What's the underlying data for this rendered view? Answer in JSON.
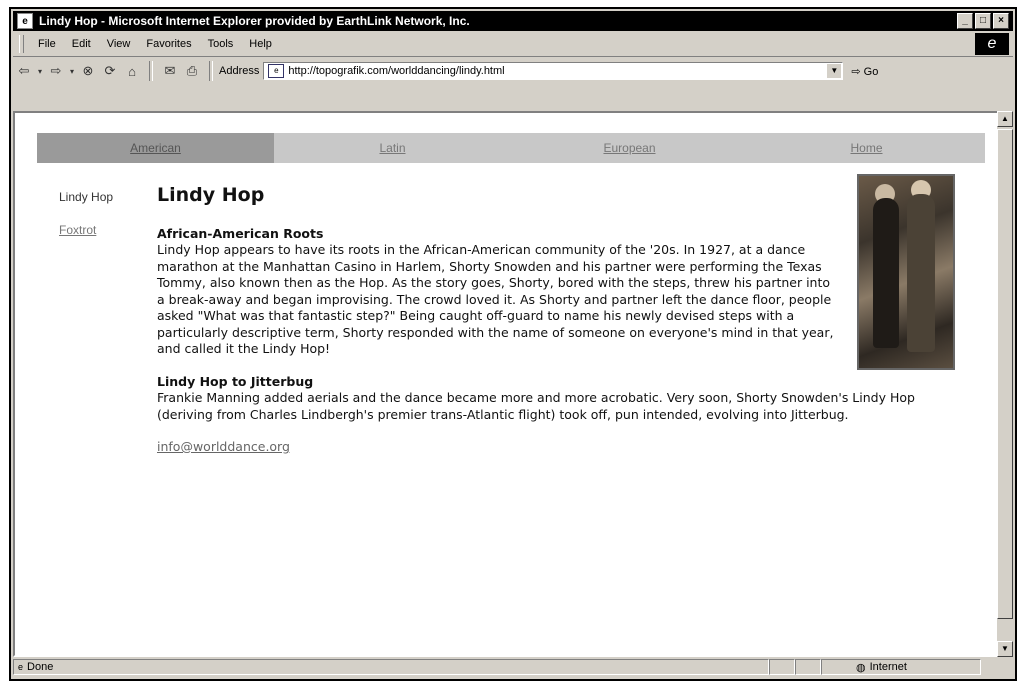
{
  "window": {
    "title": "Lindy Hop - Microsoft Internet Explorer provided by EarthLink Network, Inc.",
    "controls": [
      "_",
      "□",
      "×"
    ]
  },
  "menu": [
    "File",
    "Edit",
    "View",
    "Favorites",
    "Tools",
    "Help"
  ],
  "toolbar": {
    "address_label": "Address",
    "url": "http://topografik.com/worlddancing/lindy.html",
    "go_label": "Go"
  },
  "status": {
    "left": "Done",
    "zone": "Internet"
  },
  "page": {
    "nav": [
      "American",
      "Latin",
      "European",
      "Home"
    ],
    "side_current": "Lindy Hop",
    "side_link": "Foxtrot",
    "title": "Lindy Hop",
    "section1_heading": "African-American Roots",
    "section1_text": "Lindy Hop appears to have its roots in the African-American community of the '20s. In 1927, at a dance marathon at the Manhattan Casino in Harlem, Shorty Snowden and his partner were performing the Texas Tommy, also known then as the Hop. As the story goes, Shorty, bored with the steps, threw his partner into a break-away and began improvising. The crowd loved it. As Shorty and partner left the dance floor, people asked \"What was that fantastic step?\" Being caught off-guard to name his newly devised steps with a particularly descriptive term, Shorty responded with the name of someone on everyone's mind in that year, and called it the Lindy Hop!",
    "section2_heading": "Lindy Hop to Jitterbug",
    "section2_text": "Frankie Manning added aerials and the dance became more and more acrobatic. Very soon, Shorty Snowden's Lindy Hop (deriving from Charles Lindbergh's premier trans-Atlantic flight) took off, pun intended, evolving into Jitterbug.",
    "email": "info@worlddance.org"
  }
}
